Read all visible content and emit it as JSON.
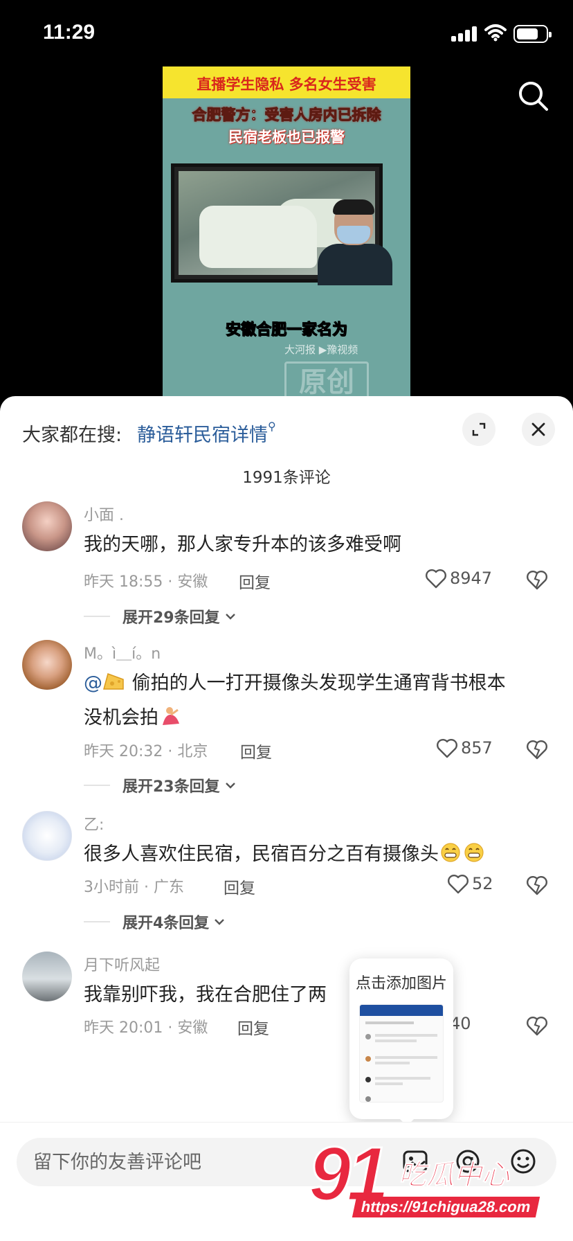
{
  "status": {
    "time": "11:29",
    "battery_level": 0.75
  },
  "video": {
    "line2": "直播学生隐私  多名女生受害",
    "line3": "合肥警方：受害人房内已拆除",
    "line4": "民宿老板也已报警",
    "subtitle": "安徽合肥一家名为",
    "logo": "大河报 ▶豫视频",
    "stamp": "原创"
  },
  "sheet": {
    "hot_prefix": "大家都在搜:",
    "hot_term": "静语轩民宿详情",
    "comment_count": "1991条评论"
  },
  "comments": [
    {
      "user": "小面 .",
      "text": "我的天哪，那人家专升本的该多难受啊",
      "time_location": "昨天 18:55 · 安徽",
      "reply": "回复",
      "likes": "8947",
      "expand": "展开29条回复"
    },
    {
      "user": "M。ì＿í。n",
      "mention": "@",
      "text_line1": "偷拍的人一打开摄像头发现学生通宵背书根本",
      "text_line2": "没机会拍",
      "time_location": "昨天 20:32 · 北京",
      "reply": "回复",
      "likes": "857",
      "expand": "展开23条回复"
    },
    {
      "user": "乙:",
      "text": "很多人喜欢住民宿，民宿百分之百有摄像头",
      "time_location": "3小时前 · 广东",
      "reply": "回复",
      "likes": "52",
      "expand": "展开4条回复"
    },
    {
      "user": "月下听风起",
      "text": "我靠别吓我，我在合肥住了两",
      "time_location": "昨天 20:01 · 安徽",
      "reply": "回复",
      "likes": "40"
    }
  ],
  "popup": {
    "title": "点击添加图片"
  },
  "input": {
    "placeholder": "留下你的友善评论吧"
  },
  "watermark": {
    "big": "91",
    "name": "吃瓜中心",
    "url": "https://91chigua28.com"
  },
  "colors": {
    "accent_link": "#2b5d9a",
    "watermark_red": "#e8283f",
    "video_banner": "#f6e42e"
  }
}
